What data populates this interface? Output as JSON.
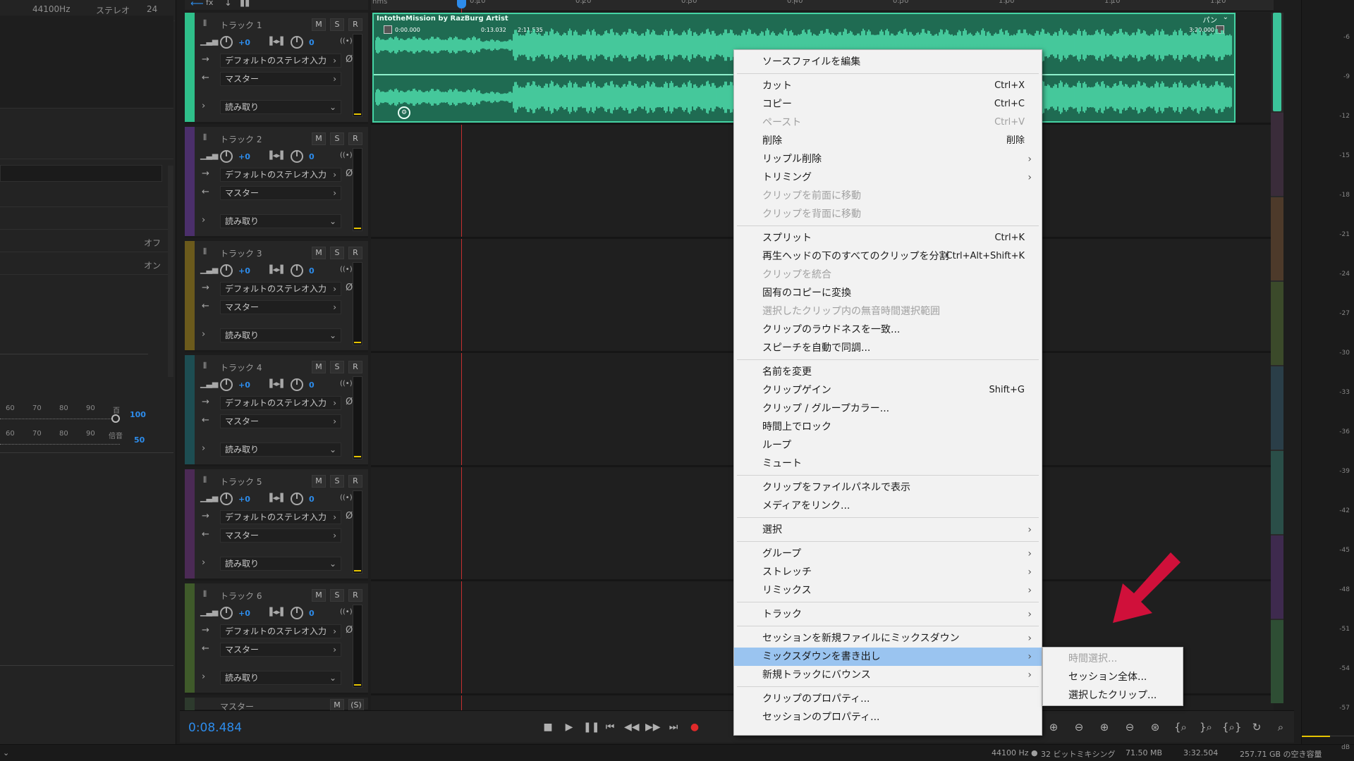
{
  "left_panel": {
    "top_sample_rate": "44100Hz",
    "top_channel": "ステレオ",
    "top_bits": "24",
    "off_label": "オフ",
    "on_label": "オン",
    "ruler1": {
      "ticks": [
        "60",
        "70",
        "80",
        "90",
        "百"
      ],
      "value": "100"
    },
    "ruler2": {
      "ticks": [
        "60",
        "70",
        "80",
        "90",
        "倍音"
      ],
      "value": "50"
    }
  },
  "tracks": [
    {
      "name": "トラック 1",
      "vol": "+0",
      "pan": "0",
      "input": "デフォルトのステレオ入力",
      "output": "マスター",
      "automation": "読み取り",
      "color": "#2fbf8a"
    },
    {
      "name": "トラック 2",
      "vol": "+0",
      "pan": "0",
      "input": "デフォルトのステレオ入力",
      "output": "マスター",
      "automation": "読み取り",
      "color": "#4b2f6b"
    },
    {
      "name": "トラック 3",
      "vol": "+0",
      "pan": "0",
      "input": "デフォルトのステレオ入力",
      "output": "マスター",
      "automation": "読み取り",
      "color": "#6b5a1c"
    },
    {
      "name": "トラック 4",
      "vol": "+0",
      "pan": "0",
      "input": "デフォルトのステレオ入力",
      "output": "マスター",
      "automation": "読み取り",
      "color": "#1d4d52"
    },
    {
      "name": "トラック 5",
      "vol": "+0",
      "pan": "0",
      "input": "デフォルトのステレオ入力",
      "output": "マスター",
      "automation": "読み取り",
      "color": "#4b2a55"
    },
    {
      "name": "トラック 6",
      "vol": "+0",
      "pan": "0",
      "input": "デフォルトのステレオ入力",
      "output": "マスター",
      "automation": "読み取り",
      "color": "#3f5a2a"
    }
  ],
  "msr": {
    "m": "M",
    "s": "S",
    "r": "R"
  },
  "master_track": {
    "name": "マスター",
    "m": "M",
    "s": "(S)"
  },
  "clip": {
    "title": "IntotheMission by RazBurg Artist",
    "pan_label": "パン",
    "t_start": "0:00.000",
    "t_mid1": "0:13.032",
    "t_mid2": "2:11.535",
    "t_end": "3:20.000"
  },
  "ruler": {
    "unit": "hms",
    "ticks": [
      "0:10",
      "0:20",
      "0:30",
      "0:40",
      "0:50",
      "1:00",
      "1:10",
      "1:20"
    ]
  },
  "transport": {
    "time": "0:08.484"
  },
  "status_bar": {
    "sample_rate": "44100 Hz",
    "bit_depth": "32 ビットミキシング",
    "size": "71.50 MB",
    "duration": "3:32.504",
    "free_space": "257.71 GB の空き容量"
  },
  "level_meter": {
    "db_labels": [
      "-6",
      "-9",
      "-12",
      "-15",
      "-18",
      "-21",
      "-24",
      "-27",
      "-30",
      "-33",
      "-36",
      "-39",
      "-42",
      "-45",
      "-48",
      "-51",
      "-54",
      "-57",
      "dB"
    ]
  },
  "context_menu": {
    "items": [
      {
        "label": "ソースファイルを編集",
        "shortcut": "",
        "disabled": false,
        "submenu": false
      },
      {
        "label": "カット",
        "shortcut": "Ctrl+X",
        "disabled": false,
        "submenu": false
      },
      {
        "label": "コピー",
        "shortcut": "Ctrl+C",
        "disabled": false,
        "submenu": false
      },
      {
        "label": "ペースト",
        "shortcut": "Ctrl+V",
        "disabled": true,
        "submenu": false
      },
      {
        "label": "削除",
        "shortcut": "削除",
        "disabled": false,
        "submenu": false
      },
      {
        "label": "リップル削除",
        "shortcut": "",
        "disabled": false,
        "submenu": true
      },
      {
        "label": "トリミング",
        "shortcut": "",
        "disabled": false,
        "submenu": true
      },
      {
        "label": "クリップを前面に移動",
        "shortcut": "",
        "disabled": true,
        "submenu": false
      },
      {
        "label": "クリップを背面に移動",
        "shortcut": "",
        "disabled": true,
        "submenu": false
      },
      {
        "label": "スプリット",
        "shortcut": "Ctrl+K",
        "disabled": false,
        "submenu": false
      },
      {
        "label": "再生ヘッドの下のすべてのクリップを分割",
        "shortcut": "Ctrl+Alt+Shift+K",
        "disabled": false,
        "submenu": false
      },
      {
        "label": "クリップを統合",
        "shortcut": "",
        "disabled": true,
        "submenu": false
      },
      {
        "label": "固有のコピーに変換",
        "shortcut": "",
        "disabled": false,
        "submenu": false
      },
      {
        "label": "選択したクリップ内の無音時間選択範囲",
        "shortcut": "",
        "disabled": true,
        "submenu": false
      },
      {
        "label": "クリップのラウドネスを一致...",
        "shortcut": "",
        "disabled": false,
        "submenu": false
      },
      {
        "label": "スピーチを自動で同調...",
        "shortcut": "",
        "disabled": false,
        "submenu": false
      },
      {
        "label": "名前を変更",
        "shortcut": "",
        "disabled": false,
        "submenu": false
      },
      {
        "label": "クリップゲイン",
        "shortcut": "Shift+G",
        "disabled": false,
        "submenu": false
      },
      {
        "label": "クリップ / グループカラー...",
        "shortcut": "",
        "disabled": false,
        "submenu": false
      },
      {
        "label": "時間上でロック",
        "shortcut": "",
        "disabled": false,
        "submenu": false
      },
      {
        "label": "ループ",
        "shortcut": "",
        "disabled": false,
        "submenu": false
      },
      {
        "label": "ミュート",
        "shortcut": "",
        "disabled": false,
        "submenu": false
      },
      {
        "label": "クリップをファイルパネルで表示",
        "shortcut": "",
        "disabled": false,
        "submenu": false
      },
      {
        "label": "メディアをリンク...",
        "shortcut": "",
        "disabled": false,
        "submenu": false
      },
      {
        "label": "選択",
        "shortcut": "",
        "disabled": false,
        "submenu": true
      },
      {
        "label": "グループ",
        "shortcut": "",
        "disabled": false,
        "submenu": true
      },
      {
        "label": "ストレッチ",
        "shortcut": "",
        "disabled": false,
        "submenu": true
      },
      {
        "label": "リミックス",
        "shortcut": "",
        "disabled": false,
        "submenu": true
      },
      {
        "label": "トラック",
        "shortcut": "",
        "disabled": false,
        "submenu": true
      },
      {
        "label": "セッションを新規ファイルにミックスダウン",
        "shortcut": "",
        "disabled": false,
        "submenu": true
      },
      {
        "label": "ミックスダウンを書き出し",
        "shortcut": "",
        "disabled": false,
        "submenu": true,
        "highlighted": true
      },
      {
        "label": "新規トラックにバウンス",
        "shortcut": "",
        "disabled": false,
        "submenu": true
      },
      {
        "label": "クリップのプロパティ...",
        "shortcut": "",
        "disabled": false,
        "submenu": false
      },
      {
        "label": "セッションのプロパティ...",
        "shortcut": "",
        "disabled": false,
        "submenu": false
      }
    ]
  },
  "submenu": {
    "items": [
      {
        "label": "時間選択...",
        "disabled": true
      },
      {
        "label": "セッション全体...",
        "disabled": false
      },
      {
        "label": "選択したクリップ...",
        "disabled": false
      }
    ]
  },
  "colors": {
    "accent": "#2d8ceb",
    "clip": "#45d4a4",
    "playhead": "#c63030",
    "annotation_arrow": "#d0103a"
  }
}
